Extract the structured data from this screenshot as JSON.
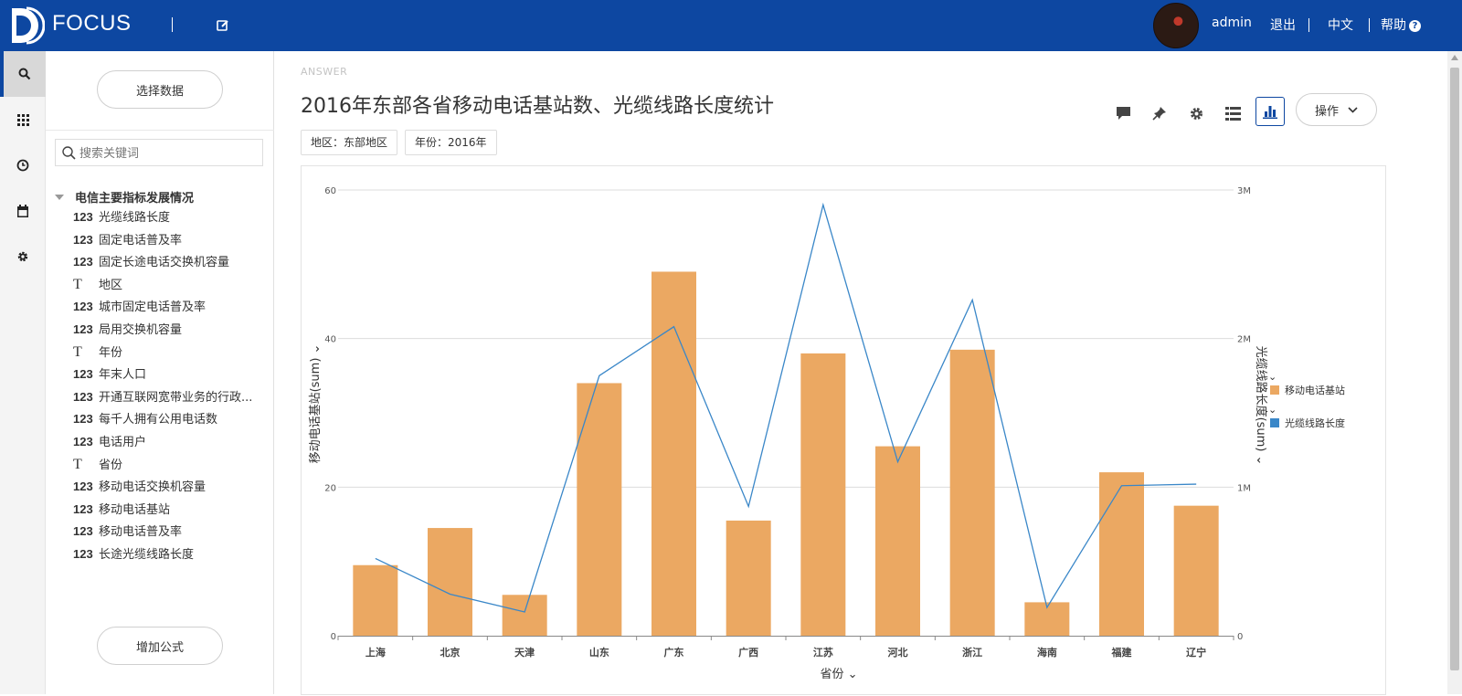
{
  "topbar": {
    "app_title": "FOCUS",
    "user": "admin",
    "logout": "退出",
    "language": "中文",
    "help": "帮助"
  },
  "panel": {
    "select_data": "选择数据",
    "search_placeholder": "搜索关键词",
    "group": "电信主要指标发展情况",
    "fields": [
      {
        "type": "123",
        "name": "光缆线路长度"
      },
      {
        "type": "123",
        "name": "固定电话普及率"
      },
      {
        "type": "123",
        "name": "固定长途电话交换机容量"
      },
      {
        "type": "T",
        "name": "地区"
      },
      {
        "type": "123",
        "name": "城市固定电话普及率"
      },
      {
        "type": "123",
        "name": "局用交换机容量"
      },
      {
        "type": "T",
        "name": "年份"
      },
      {
        "type": "123",
        "name": "年末人口"
      },
      {
        "type": "123",
        "name": "开通互联网宽带业务的行政..."
      },
      {
        "type": "123",
        "name": "每千人拥有公用电话数"
      },
      {
        "type": "123",
        "name": "电话用户"
      },
      {
        "type": "T",
        "name": "省份"
      },
      {
        "type": "123",
        "name": "移动电话交换机容量"
      },
      {
        "type": "123",
        "name": "移动电话基站"
      },
      {
        "type": "123",
        "name": "移动电话普及率"
      },
      {
        "type": "123",
        "name": "长途光缆线路长度"
      }
    ],
    "add_formula": "增加公式"
  },
  "main": {
    "answer_tag": "ANSWER",
    "title": "2016年东部各省移动电话基站数、光缆线路长度统计",
    "filters": [
      "地区：东部地区",
      "年份：2016年"
    ],
    "ops": "操作"
  },
  "colors": {
    "brand": "#0d47a1",
    "bar": "#eba862",
    "line": "#3a87c8"
  },
  "chart_data": {
    "type": "bar",
    "categories": [
      "上海",
      "北京",
      "天津",
      "山东",
      "广东",
      "广西",
      "江苏",
      "河北",
      "浙江",
      "海南",
      "福建",
      "辽宁"
    ],
    "series": [
      {
        "name": "移动电话基站",
        "type": "bar",
        "axis": "left",
        "values": [
          9.5,
          14.5,
          5.5,
          34,
          49,
          15.5,
          38,
          25.5,
          38.5,
          4.5,
          22,
          17.5
        ]
      },
      {
        "name": "光缆线路长度",
        "type": "line",
        "axis": "right",
        "values": [
          520000,
          280000,
          160000,
          1750000,
          2080000,
          870000,
          2900000,
          1170000,
          2260000,
          190000,
          1010000,
          1020000
        ]
      }
    ],
    "xlabel": "省份",
    "ylabel": "移动电话基站(sum)",
    "y2label": "光缆线路长度(sum)",
    "ylim": [
      0,
      60
    ],
    "y2lim": [
      0,
      3000000
    ],
    "yticks": [
      "0",
      "20",
      "40",
      "60"
    ],
    "y2ticks": [
      "0",
      "1M",
      "2M",
      "3M"
    ],
    "grid": true,
    "legend": "right"
  }
}
